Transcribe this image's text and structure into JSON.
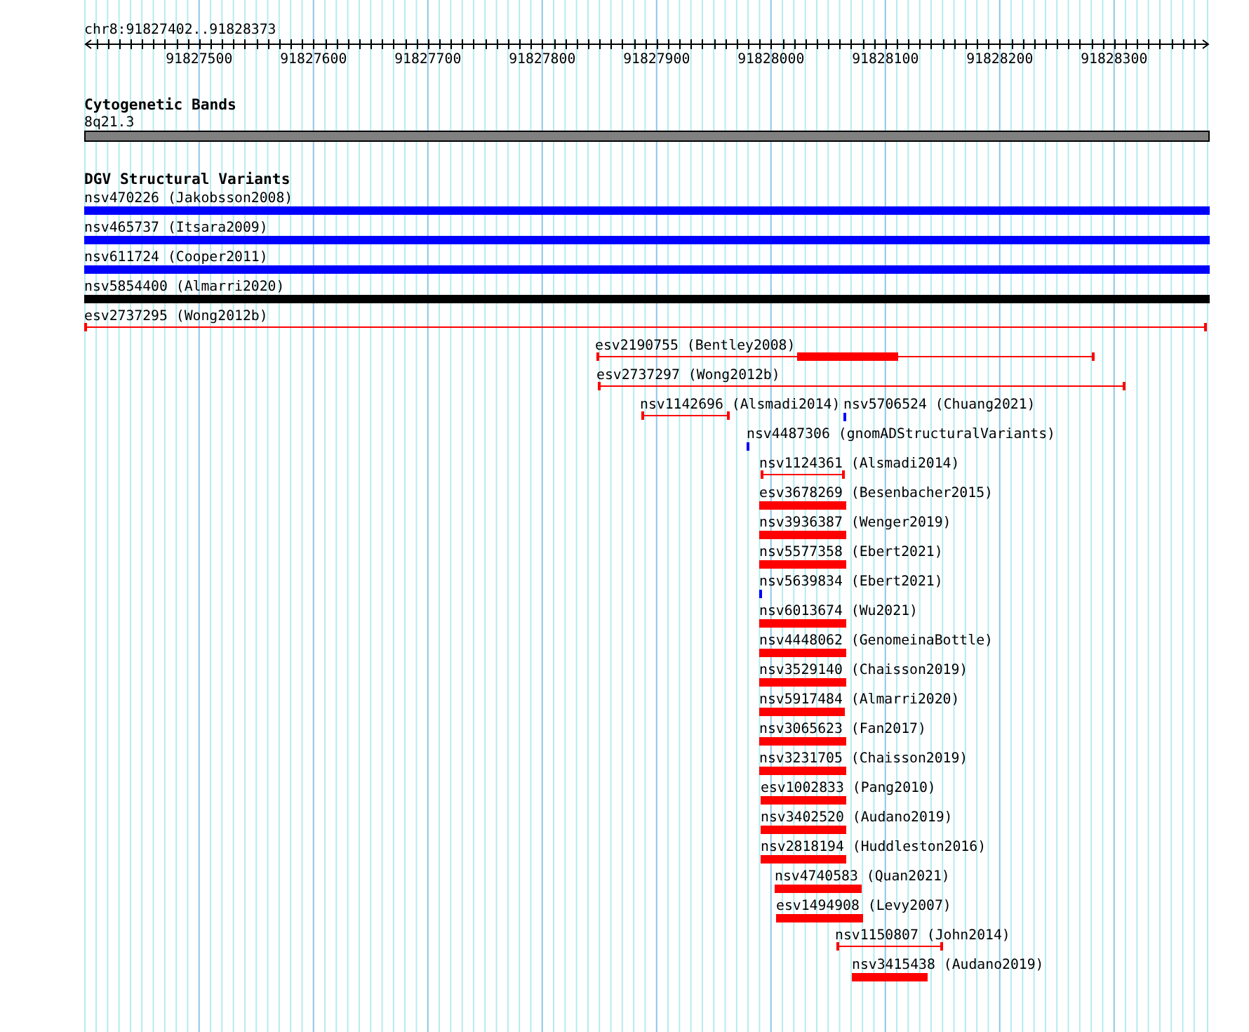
{
  "ruler": {
    "position": "chr8:91827402..91828373",
    "labels": [
      "91827500",
      "91827600",
      "91827700",
      "91827800",
      "91827900",
      "91828000",
      "91828100",
      "91828200",
      "91828300"
    ]
  },
  "tracks": [
    {
      "title": "Cytogenetic Bands",
      "features": [
        {
          "label": "8q21.3",
          "kind": "band"
        }
      ]
    },
    {
      "title": "DGV Structural Variants",
      "features": [
        {
          "label": "nsv470226 (Jakobsson2008)",
          "kind": "bar",
          "color": "#0000ff"
        },
        {
          "label": "nsv465737 (Itsara2009)",
          "kind": "bar",
          "color": "#0000ff"
        },
        {
          "label": "nsv611724 (Cooper2011)",
          "kind": "bar",
          "color": "#0000ff"
        },
        {
          "label": "nsv5854400 (Almarri2020)",
          "kind": "bar",
          "color": "#000000"
        },
        {
          "label": "esv2737295 (Wong2012b)",
          "kind": "span",
          "color": "#ff0000"
        },
        {
          "label": "esv2190755 (Bentley2008)",
          "kind": "span-block",
          "color": "#ff0000"
        },
        {
          "label": "esv2737297 (Wong2012b)",
          "kind": "span",
          "color": "#ff0000"
        },
        {
          "label": "nsv1142696 (Alsmadi2014)",
          "kind": "span",
          "color": "#ff0000"
        },
        {
          "label": "nsv5706524 (Chuang2021)",
          "kind": "point",
          "color": "#0000ff"
        },
        {
          "label": "nsv4487306 (gnomADStructuralVariants)",
          "kind": "point",
          "color": "#0000ff"
        },
        {
          "label": "nsv1124361 (Alsmadi2014)",
          "kind": "span",
          "color": "#ff0000"
        },
        {
          "label": "esv3678269 (Besenbacher2015)",
          "kind": "bar",
          "color": "#ff0000"
        },
        {
          "label": "nsv3936387 (Wenger2019)",
          "kind": "bar",
          "color": "#ff0000"
        },
        {
          "label": "nsv5577358 (Ebert2021)",
          "kind": "bar",
          "color": "#ff0000"
        },
        {
          "label": "nsv5639834 (Ebert2021)",
          "kind": "point",
          "color": "#0000ff"
        },
        {
          "label": "nsv6013674 (Wu2021)",
          "kind": "bar",
          "color": "#ff0000"
        },
        {
          "label": "nsv4448062 (GenomeinaBottle)",
          "kind": "bar",
          "color": "#ff0000"
        },
        {
          "label": "nsv3529140 (Chaisson2019)",
          "kind": "bar",
          "color": "#ff0000"
        },
        {
          "label": "nsv5917484 (Almarri2020)",
          "kind": "bar",
          "color": "#ff0000"
        },
        {
          "label": "nsv3065623 (Fan2017)",
          "kind": "bar",
          "color": "#ff0000"
        },
        {
          "label": "nsv3231705 (Chaisson2019)",
          "kind": "bar",
          "color": "#ff0000"
        },
        {
          "label": "esv1002833 (Pang2010)",
          "kind": "bar",
          "color": "#ff0000"
        },
        {
          "label": "nsv3402520 (Audano2019)",
          "kind": "bar",
          "color": "#ff0000"
        },
        {
          "label": "nsv2818194 (Huddleston2016)",
          "kind": "bar",
          "color": "#ff0000"
        },
        {
          "label": "nsv4740583 (Quan2021)",
          "kind": "bar",
          "color": "#ff0000"
        },
        {
          "label": "esv1494908 (Levy2007)",
          "kind": "bar",
          "color": "#ff0000"
        },
        {
          "label": "nsv1150807 (John2014)",
          "kind": "span",
          "color": "#ff0000"
        },
        {
          "label": "nsv3415438 (Audano2019)",
          "kind": "bar",
          "color": "#ff0000"
        }
      ]
    }
  ]
}
